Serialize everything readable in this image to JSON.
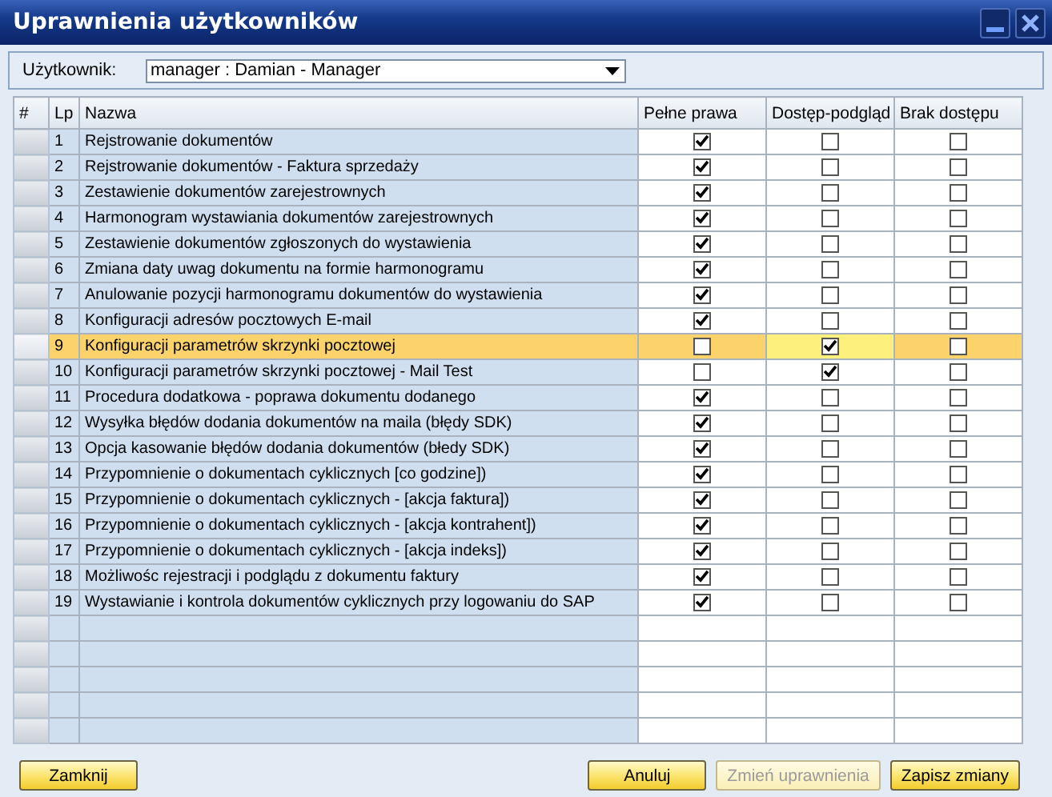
{
  "window": {
    "title": "Uprawnienia użytkowników"
  },
  "user": {
    "label": "Użytkownik:",
    "value": "manager : Damian - Manager"
  },
  "table": {
    "columns": [
      "#",
      "Lp",
      "Nazwa",
      "Pełne prawa",
      "Dostęp-podgląd",
      "Brak dostępu"
    ],
    "rows": [
      {
        "lp": "1",
        "name": "Rejstrowanie dokumentów",
        "full": true,
        "view": false,
        "none": false,
        "selected": false
      },
      {
        "lp": "2",
        "name": "Rejstrowanie dokumentów - Faktura sprzedaży",
        "full": true,
        "view": false,
        "none": false,
        "selected": false
      },
      {
        "lp": "3",
        "name": "Zestawienie dokumentów zarejestrownych",
        "full": true,
        "view": false,
        "none": false,
        "selected": false
      },
      {
        "lp": "4",
        "name": "Harmonogram wystawiania dokumentów zarejestrownych",
        "full": true,
        "view": false,
        "none": false,
        "selected": false
      },
      {
        "lp": "5",
        "name": "Zestawienie dokumentów zgłoszonych do wystawienia",
        "full": true,
        "view": false,
        "none": false,
        "selected": false
      },
      {
        "lp": "6",
        "name": "Zmiana daty uwag dokumentu na formie harmonogramu",
        "full": true,
        "view": false,
        "none": false,
        "selected": false
      },
      {
        "lp": "7",
        "name": "Anulowanie pozycji harmonogramu dokumentów do wystawienia",
        "full": true,
        "view": false,
        "none": false,
        "selected": false
      },
      {
        "lp": "8",
        "name": "Konfiguracji adresów pocztowych E-mail",
        "full": true,
        "view": false,
        "none": false,
        "selected": false
      },
      {
        "lp": "9",
        "name": "Konfiguracji parametrów skrzynki pocztowej",
        "full": false,
        "view": true,
        "none": false,
        "selected": true
      },
      {
        "lp": "10",
        "name": "Konfiguracji parametrów skrzynki pocztowej - Mail Test",
        "full": false,
        "view": true,
        "none": false,
        "selected": false
      },
      {
        "lp": "11",
        "name": "Procedura dodatkowa - poprawa dokumentu dodanego",
        "full": true,
        "view": false,
        "none": false,
        "selected": false
      },
      {
        "lp": "12",
        "name": "Wysyłka błędów dodania dokumentów na maila (błędy SDK)",
        "full": true,
        "view": false,
        "none": false,
        "selected": false
      },
      {
        "lp": "13",
        "name": "Opcja kasowanie błędów dodania dokumentów (błedy SDK)",
        "full": true,
        "view": false,
        "none": false,
        "selected": false
      },
      {
        "lp": "14",
        "name": "Przypomnienie o dokumentach cyklicznych [co godzine])",
        "full": true,
        "view": false,
        "none": false,
        "selected": false
      },
      {
        "lp": "15",
        "name": "Przypomnienie o dokumentach cyklicznych - [akcja faktura])",
        "full": true,
        "view": false,
        "none": false,
        "selected": false
      },
      {
        "lp": "16",
        "name": "Przypomnienie o dokumentach cyklicznych - [akcja kontrahent])",
        "full": true,
        "view": false,
        "none": false,
        "selected": false
      },
      {
        "lp": "17",
        "name": "Przypomnienie o dokumentach cyklicznych - [akcja indeks])",
        "full": true,
        "view": false,
        "none": false,
        "selected": false
      },
      {
        "lp": "18",
        "name": "Możliwośc rejestracji i podglądu z dokumentu faktury",
        "full": true,
        "view": false,
        "none": false,
        "selected": false
      },
      {
        "lp": "19",
        "name": "Wystawianie i kontrola dokumentów cyklicznych przy logowaniu do SAP",
        "full": true,
        "view": false,
        "none": false,
        "selected": false
      }
    ]
  },
  "buttons": [
    {
      "label": "Zamknij",
      "disabled": false
    },
    {
      "label": "Anuluj",
      "disabled": false
    },
    {
      "label": "Zmień uprawnienia",
      "disabled": true
    },
    {
      "label": "Zapisz zmiany",
      "disabled": false
    }
  ]
}
